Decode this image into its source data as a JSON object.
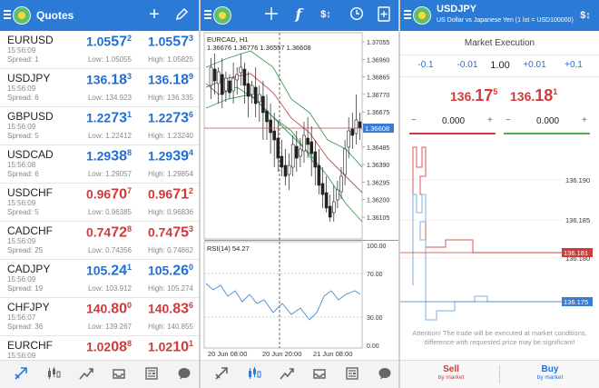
{
  "quotes_panel": {
    "title": "Quotes",
    "rows": [
      {
        "symbol": "EURUSD",
        "time": "15:56:09",
        "spread": "Spread: 1",
        "bid_pre": "1.05",
        "bid_big": "57",
        "bid_sup": "2",
        "ask_pre": "1.05",
        "ask_big": "57",
        "ask_sup": "3",
        "low": "Low: 1.05055",
        "high": "High: 1.05825",
        "color": "blue"
      },
      {
        "symbol": "USDJPY",
        "time": "15:56:09",
        "spread": "Spread: 6",
        "bid_pre": "136.",
        "bid_big": "18",
        "bid_sup": "3",
        "ask_pre": "136.",
        "ask_big": "18",
        "ask_sup": "9",
        "low": "Low: 134.923",
        "high": "High: 136.335",
        "color": "blue"
      },
      {
        "symbol": "GBPUSD",
        "time": "15:56:09",
        "spread": "Spread: 5",
        "bid_pre": "1.22",
        "bid_big": "73",
        "bid_sup": "1",
        "ask_pre": "1.22",
        "ask_big": "73",
        "ask_sup": "6",
        "low": "Low: 1.22412",
        "high": "High: 1.23240",
        "color": "blue"
      },
      {
        "symbol": "USDCAD",
        "time": "15:56:08",
        "spread": "Spread: 6",
        "bid_pre": "1.29",
        "bid_big": "38",
        "bid_sup": "8",
        "ask_pre": "1.29",
        "ask_big": "39",
        "ask_sup": "4",
        "low": "Low: 1.29057",
        "high": "High: 1.29854",
        "color": "blue"
      },
      {
        "symbol": "USDCHF",
        "time": "15:56:09",
        "spread": "Spread: 5",
        "bid_pre": "0.96",
        "bid_big": "70",
        "bid_sup": "7",
        "ask_pre": "0.96",
        "ask_big": "71",
        "ask_sup": "2",
        "low": "Low: 0.96385",
        "high": "High: 0.96836",
        "color": "red"
      },
      {
        "symbol": "CADCHF",
        "time": "15:56:09",
        "spread": "Spread: 25",
        "bid_pre": "0.74",
        "bid_big": "72",
        "bid_sup": "8",
        "ask_pre": "0.74",
        "ask_big": "75",
        "ask_sup": "3",
        "low": "Low: 0.74356",
        "high": "High: 0.74862",
        "color": "red"
      },
      {
        "symbol": "CADJPY",
        "time": "15:56:09",
        "spread": "Spread: 19",
        "bid_pre": "105.",
        "bid_big": "24",
        "bid_sup": "1",
        "ask_pre": "105.",
        "ask_big": "26",
        "ask_sup": "0",
        "low": "Low: 103.912",
        "high": "High: 105.274",
        "color": "blue"
      },
      {
        "symbol": "CHFJPY",
        "time": "15:56:07",
        "spread": "Spread: 36",
        "bid_pre": "140.",
        "bid_big": "80",
        "bid_sup": "0",
        "ask_pre": "140.",
        "ask_big": "83",
        "ask_sup": "6",
        "low": "Low: 139.267",
        "high": "High: 140.855",
        "color": "red"
      },
      {
        "symbol": "EURCHF",
        "time": "15:56:09",
        "spread": "Spread: 13",
        "bid_pre": "1.02",
        "bid_big": "08",
        "bid_sup": "8",
        "ask_pre": "1.02",
        "ask_big": "10",
        "ask_sup": "1",
        "low": "Low: 1.01606",
        "high": "High: 1.02150",
        "color": "red"
      }
    ],
    "nav_icons": [
      "quotes-icon",
      "chart-candles-icon",
      "trend-icon",
      "inbox-icon",
      "news-icon",
      "chat-icon"
    ]
  },
  "chart_panel": {
    "symbol_tf": "EURCAD, H1",
    "ohlc": "1.36676 1.36776 1.36557 1.36608",
    "price_ticks": [
      "1.37055",
      "1.36960",
      "1.36865",
      "1.36770",
      "1.36675",
      "1.36580",
      "1.36485",
      "1.36390",
      "1.36295",
      "1.36200",
      "1.36105"
    ],
    "current_price": "1.36608",
    "rsi_label": "RSI(14) 54.27",
    "rsi_ticks": [
      "100.00",
      "70.00",
      "30.00",
      "0.00"
    ],
    "time_labels": [
      "20 Jun 08:00",
      "20 Jun 20:00",
      "21 Jun 08:00"
    ],
    "nav_icons": [
      "quotes-icon",
      "chart-candles-icon",
      "trend-icon",
      "inbox-icon",
      "news-icon",
      "chat-icon"
    ],
    "colors": {
      "ma": "#c04848",
      "bands": "#3d9a54",
      "rsi": "#4a8ac9",
      "price_line": "#c04848",
      "bid_tag": "#3a7bd5"
    }
  },
  "trade_panel": {
    "title": "USDJPY",
    "subtitle": "US Dollar vs Japanese Yen (1 lot = USD100000)",
    "execution": "Market Execution",
    "volume_steps": [
      "-0.1",
      "-0.01",
      "1.00",
      "+0.01",
      "+0.1"
    ],
    "sell_price": {
      "pre": "136.",
      "big": "17",
      "sup": "5"
    },
    "buy_price": {
      "pre": "136.",
      "big": "18",
      "sup": "1"
    },
    "sl_minus": "−",
    "sl_value": "0.000",
    "sl_plus": "+",
    "tp_minus": "−",
    "tp_value": "0.000",
    "tp_plus": "+",
    "tick_ticks": [
      "136.190",
      "136.185",
      "136.180"
    ],
    "ask_tag": "136.181",
    "bid_tag": "136.175",
    "notice": "Attention! The trade will be executed at market conditions, difference with requested price may be significant!",
    "sell_label": "Sell",
    "sell_sub": "by market",
    "buy_label": "Buy",
    "buy_sub": "by market"
  }
}
